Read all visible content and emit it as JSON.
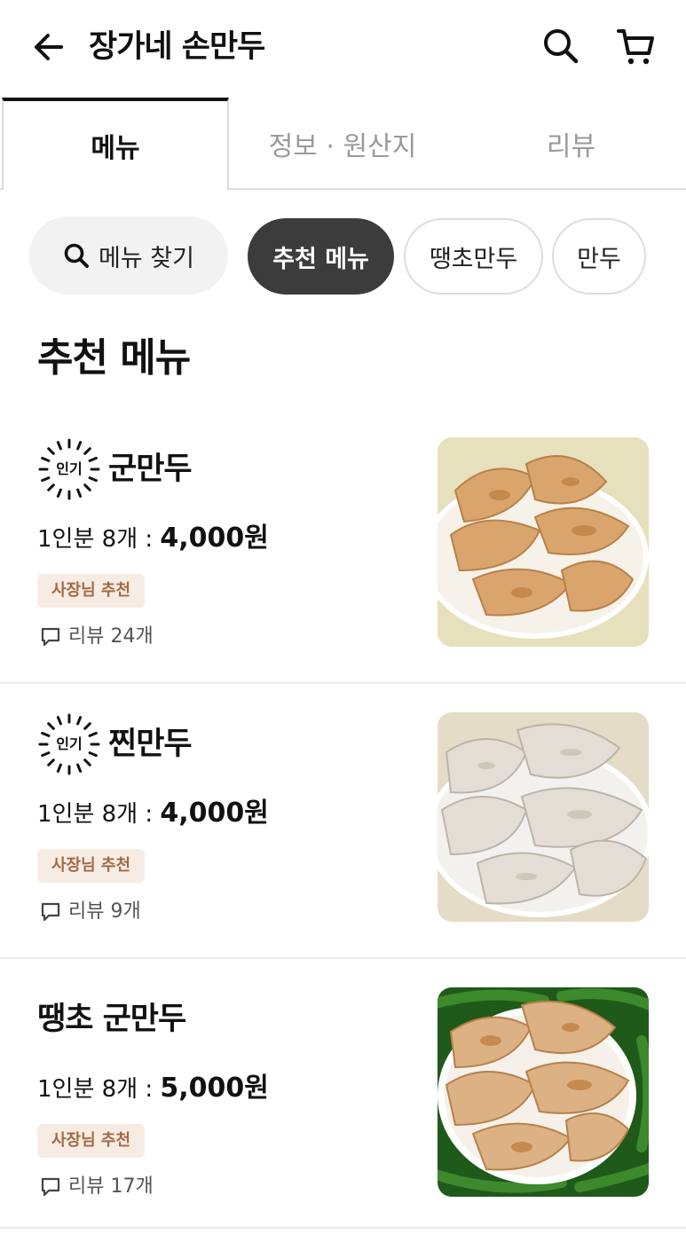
{
  "header": {
    "back_icon": "arrow-left-icon",
    "title": "장가네 손만두",
    "search_icon": "search-icon",
    "cart_icon": "cart-icon"
  },
  "tabs": [
    {
      "label": "메뉴",
      "active": true
    },
    {
      "label": "정보 · 원산지",
      "active": false
    },
    {
      "label": "리뷰",
      "active": false
    }
  ],
  "filters": {
    "search_label": "메뉴 찾기",
    "chips": [
      {
        "label": "추천 메뉴",
        "selected": true
      },
      {
        "label": "땡초만두",
        "selected": false
      },
      {
        "label": "만두",
        "selected": false
      }
    ]
  },
  "section": {
    "title": "추천 메뉴"
  },
  "items": [
    {
      "popular": true,
      "popular_label": "인기",
      "name": "군만두",
      "portion": "1인분 8개 : ",
      "price": "4,000원",
      "badge": "사장님 추천",
      "reviews": "리뷰 24개",
      "photo": "pan-fried-dumplings-on-plate"
    },
    {
      "popular": true,
      "popular_label": "인기",
      "name": "찐만두",
      "portion": "1인분 8개 : ",
      "price": "4,000원",
      "badge": "사장님 추천",
      "reviews": "리뷰 9개",
      "photo": "steamed-dumplings-on-plate"
    },
    {
      "popular": false,
      "name": "땡초 군만두",
      "portion": "1인분 8개 : ",
      "price": "5,000원",
      "badge": "사장님 추천",
      "reviews": "리뷰 17개",
      "photo": "spicy-fried-dumplings-with-peppers"
    }
  ],
  "colors": {
    "accent_dark": "#3c3c3c",
    "owner_badge_bg": "#f6ece4",
    "owner_badge_text": "#a26a44"
  }
}
